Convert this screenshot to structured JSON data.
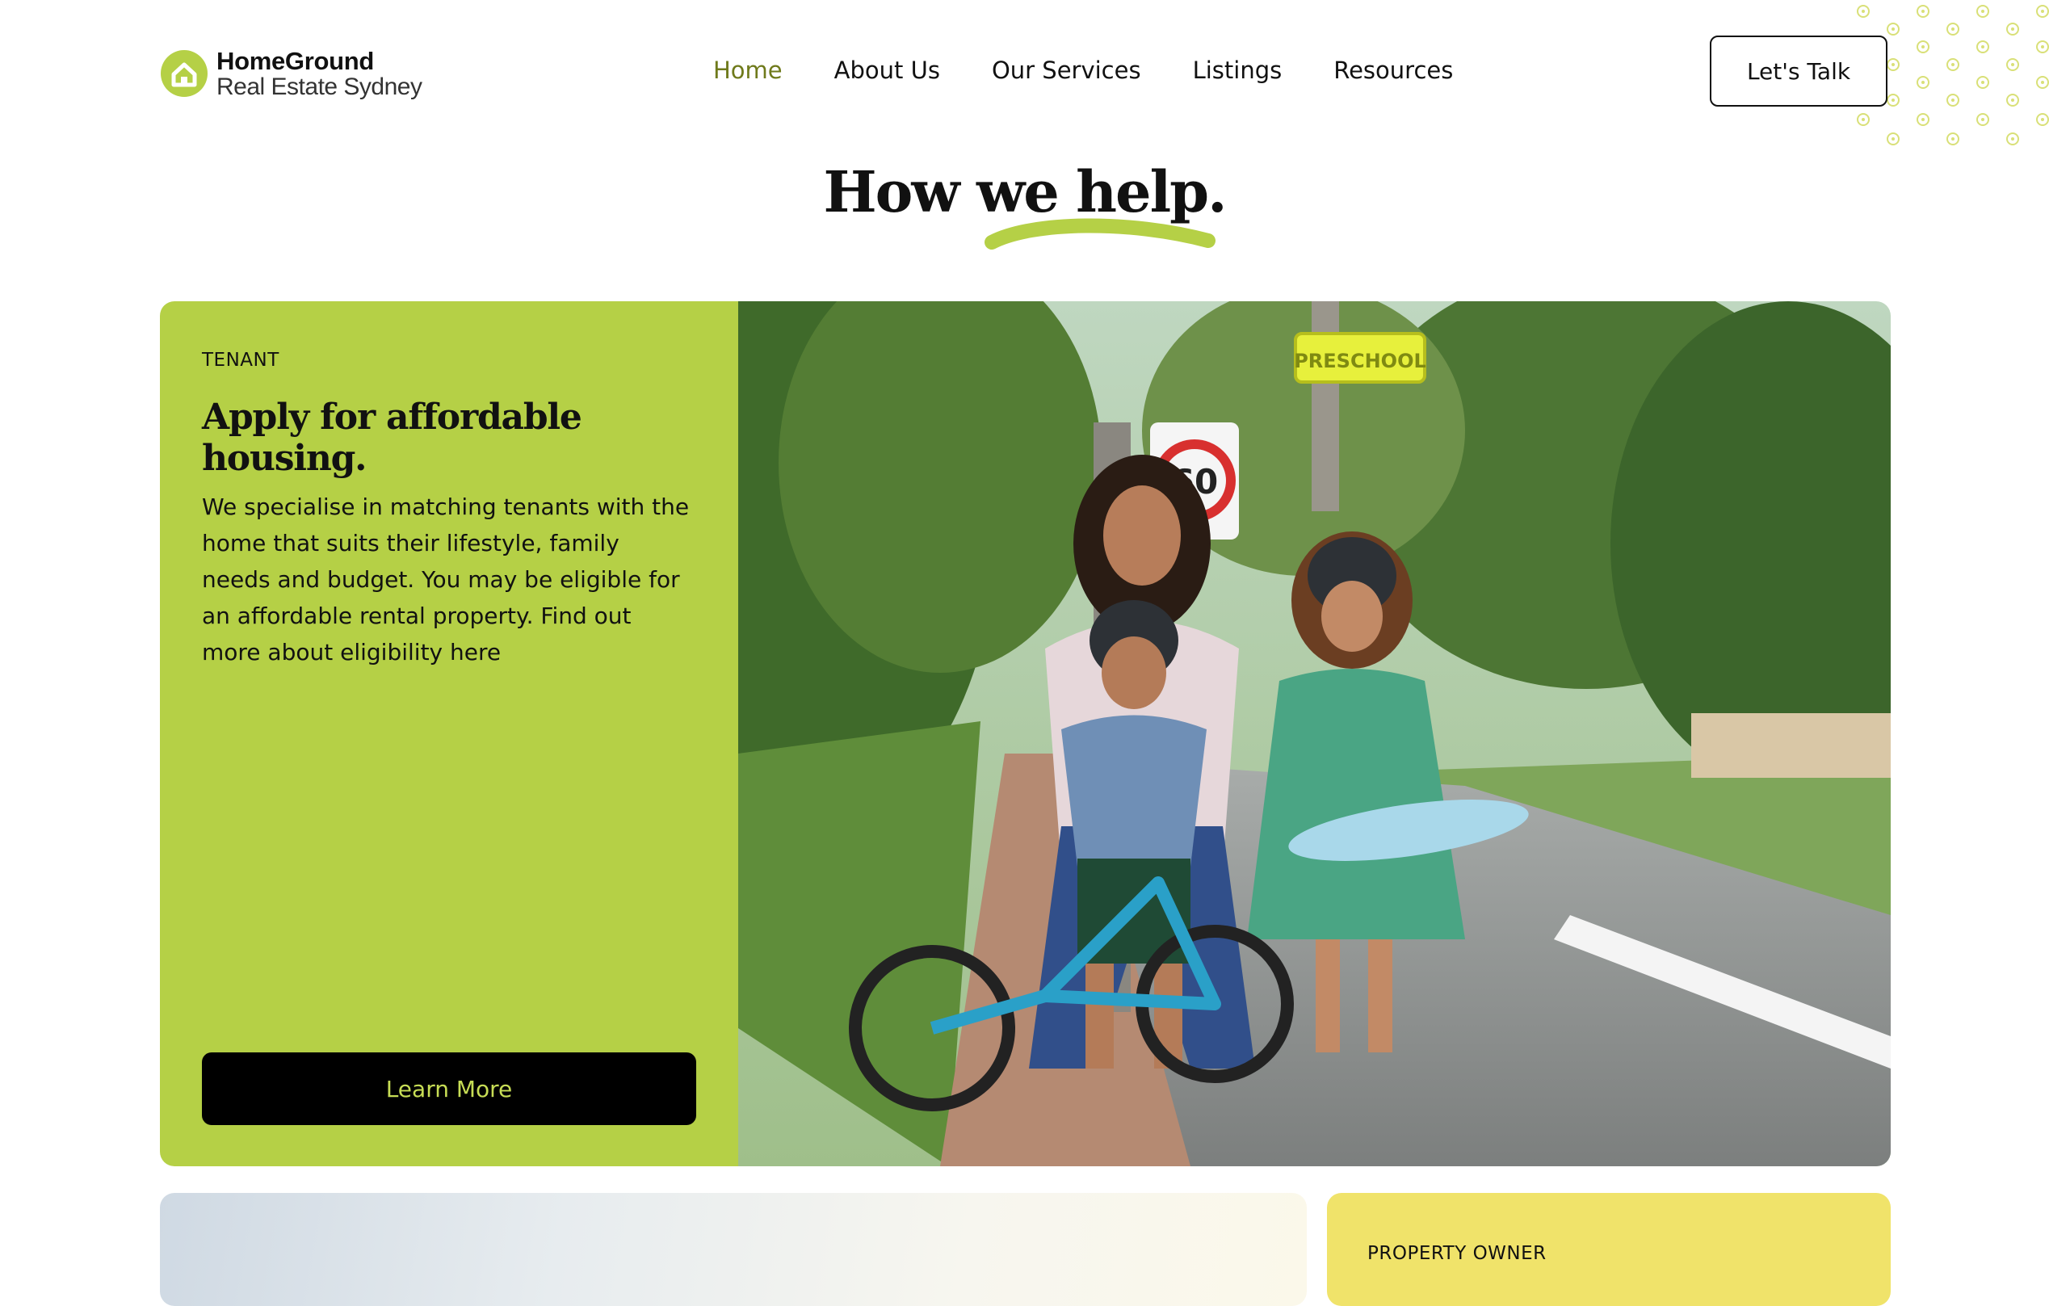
{
  "brand": {
    "name_line1": "HomeGround",
    "name_line2": "Real Estate Sydney",
    "accent_color": "#b5d046",
    "active_nav_color": "#6f7a1b",
    "property_owner_color": "#f0e36a"
  },
  "nav": {
    "items": [
      {
        "label": "Home",
        "active": true
      },
      {
        "label": "About Us",
        "active": false
      },
      {
        "label": "Our Services",
        "active": false
      },
      {
        "label": "Listings",
        "active": false
      },
      {
        "label": "Resources",
        "active": false
      }
    ],
    "cta_label": "Let's Talk"
  },
  "section": {
    "title": "How we help."
  },
  "tenant_card": {
    "eyebrow": "TENANT",
    "title": "Apply for affordable housing.",
    "body": "We specialise in matching tenants with the home that suits their lifestyle, family needs and budget. You may be eligible for an affordable rental property. Find out more about eligibility here",
    "button_label": "Learn More",
    "photo_signs": {
      "speed": "60",
      "school": "PRESCHOOL"
    }
  },
  "owner_card": {
    "eyebrow": "PROPERTY OWNER"
  },
  "icons": {
    "logo": "house-icon"
  }
}
